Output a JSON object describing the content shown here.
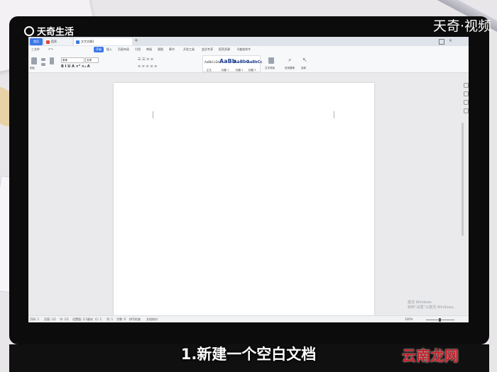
{
  "brand": {
    "name": "天奇生活",
    "right_text": "天奇·视频"
  },
  "subtitle": "1.新建一个空白文档",
  "watermark": "云南龙网",
  "app": {
    "home_tab": "首页",
    "tabs": [
      {
        "label": "稻壳",
        "icon_color": "#e0463a",
        "active": false
      },
      {
        "label": "文字文稿1",
        "icon_color": "#3c78e6",
        "active": true
      }
    ],
    "tab_add": "+",
    "menu_items": [
      "三文件",
      "开始",
      "插入",
      "页面布局",
      "引用",
      "审阅",
      "视图",
      "章节",
      "开发工具",
      "会员专享",
      "稻壳资源",
      "Q查找命令"
    ],
    "active_menu": "开始",
    "styles": [
      {
        "sample": "AaBbCcDd",
        "caption": "正文"
      },
      {
        "sample": "AaBb",
        "caption": "标题 1"
      },
      {
        "sample": "AaBbC",
        "caption": "标题 2"
      },
      {
        "sample": "AaBbCc",
        "caption": "标题 3"
      }
    ],
    "ribbon_labels": {
      "format_painter": "格式刷",
      "paste": "粘贴",
      "font": "宋体",
      "size": "五号",
      "text_tools": "文字排版",
      "find": "查找替换",
      "select": "选择"
    },
    "activation": {
      "line1": "激活 Windows",
      "line2": "转到“设置”以激活 Windows。"
    },
    "status": [
      "页码: 1",
      "页面: 1/1",
      "节: 1/1",
      "设置值: 2.5厘米",
      "行: 1",
      "列: 1",
      "字数: 0",
      "拼写检查",
      "文档校对"
    ],
    "zoom": "100%"
  }
}
